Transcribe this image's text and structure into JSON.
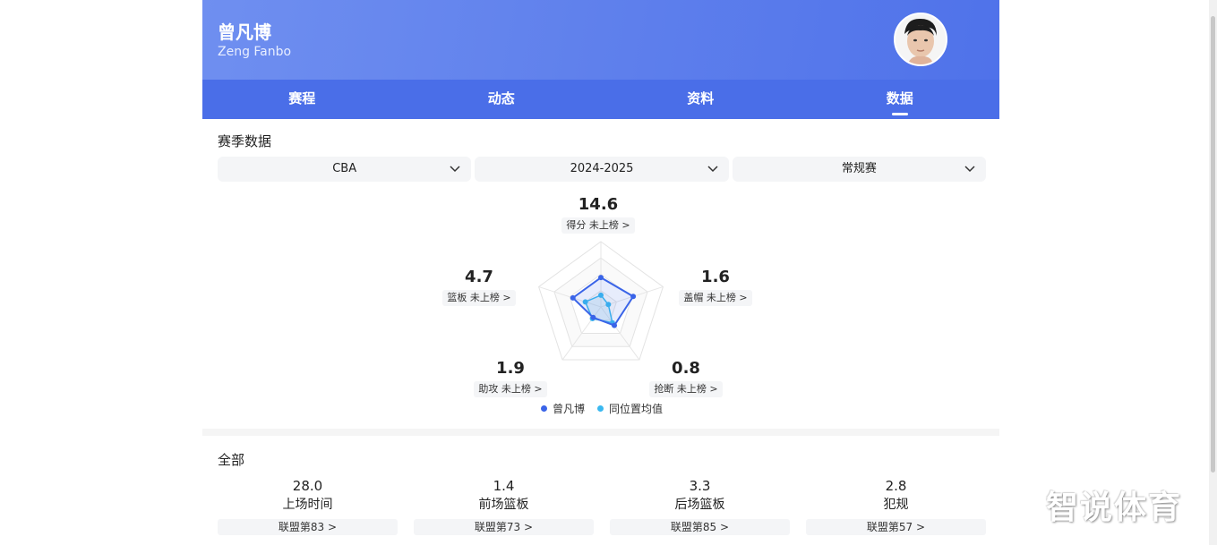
{
  "player": {
    "name": "曾凡博",
    "name_en": "Zeng Fanbo"
  },
  "tabs": [
    {
      "label": "赛程",
      "active": false
    },
    {
      "label": "动态",
      "active": false
    },
    {
      "label": "资料",
      "active": false
    },
    {
      "label": "数据",
      "active": true
    }
  ],
  "season": {
    "title": "赛季数据",
    "filters": {
      "league": "CBA",
      "season": "2024-2025",
      "type": "常规赛"
    }
  },
  "radar": {
    "stats": [
      {
        "key": "points",
        "value": "14.6",
        "rank_text": "得分 未上榜 >"
      },
      {
        "key": "blocks",
        "value": "1.6",
        "rank_text": "盖帽 未上榜 >"
      },
      {
        "key": "steals",
        "value": "0.8",
        "rank_text": "抢断 未上榜 >"
      },
      {
        "key": "assists",
        "value": "1.9",
        "rank_text": "助攻 未上榜 >"
      },
      {
        "key": "rebounds",
        "value": "4.7",
        "rank_text": "篮板 未上榜 >"
      }
    ],
    "player_fraction": [
      0.45,
      0.52,
      0.35,
      0.2,
      0.45
    ],
    "average_fraction": [
      0.18,
      0.12,
      0.3,
      0.22,
      0.25
    ],
    "legend": {
      "player": "曾凡博",
      "average": "同位置均值"
    },
    "colors": {
      "player": "#3a64e8",
      "average": "#3ab8f0"
    }
  },
  "all": {
    "title": "全部",
    "items": [
      {
        "value": "28.0",
        "label": "上场时间",
        "rank": "联盟第83 >"
      },
      {
        "value": "1.4",
        "label": "前场篮板",
        "rank": "联盟第73 >"
      },
      {
        "value": "3.3",
        "label": "后场篮板",
        "rank": "联盟第85 >"
      },
      {
        "value": "2.8",
        "label": "犯规",
        "rank": "联盟第57 >"
      }
    ]
  },
  "watermark": "智说体育"
}
